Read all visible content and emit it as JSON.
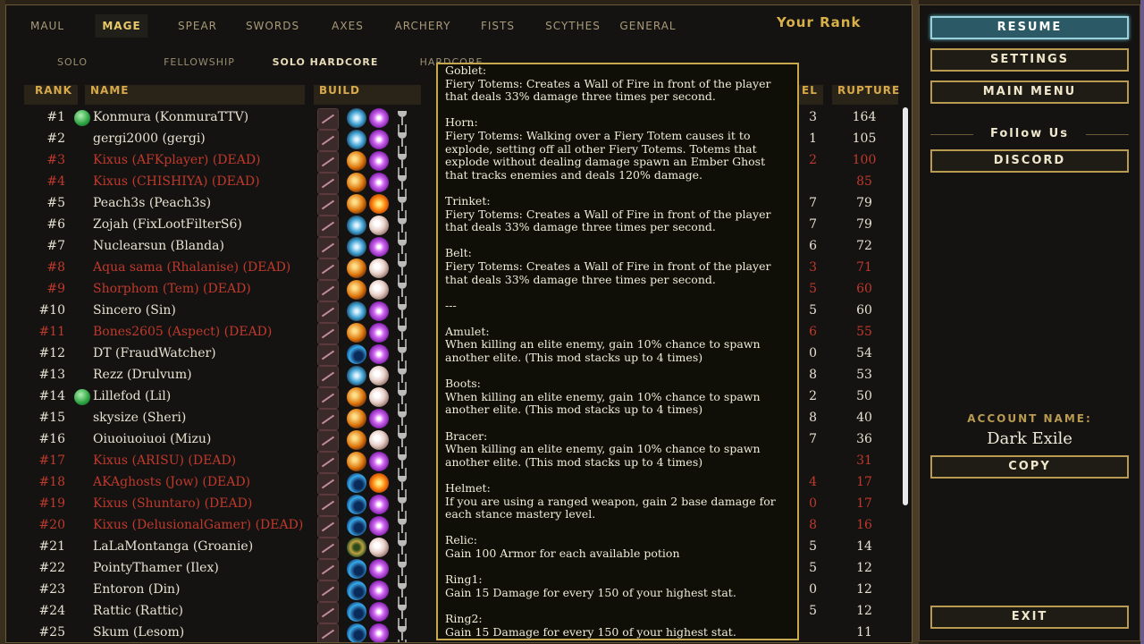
{
  "tabs": [
    "Maul",
    "Mage",
    "Spear",
    "Swords",
    "Axes",
    "Archery",
    "Fists",
    "Scythes",
    "General"
  ],
  "active_tab": "Mage",
  "your_rank_label": "Your Rank",
  "subtabs": [
    "Solo",
    "Fellowship",
    "Solo Hardcore",
    "Hardcore"
  ],
  "active_subtab": "Solo Hardcore",
  "headers": {
    "rank": "Rank",
    "name": "Name",
    "build": "Build",
    "level": "el",
    "rupture": "Rupture"
  },
  "rows": [
    {
      "rank": "#1",
      "name": "Konmura (KonmuraTTV)",
      "level": "3",
      "rupture": "164",
      "dead": false,
      "orb": true,
      "totem": "ice",
      "core": "arc"
    },
    {
      "rank": "#2",
      "name": "gergi2000 (gergi)",
      "level": "1",
      "rupture": "105",
      "dead": false,
      "orb": false,
      "totem": "ice",
      "core": "arc"
    },
    {
      "rank": "#3",
      "name": "Kixus (AFKplayer) (DEAD)",
      "level": "2",
      "rupture": "100",
      "dead": true,
      "orb": false,
      "totem": "fire",
      "core": "arc"
    },
    {
      "rank": "#4",
      "name": "Kixus (CHISHIYA) (DEAD)",
      "level": "",
      "rupture": "85",
      "dead": true,
      "orb": false,
      "totem": "fire",
      "core": "arc"
    },
    {
      "rank": "#5",
      "name": "Peach3s (Peach3s)",
      "level": "7",
      "rupture": "79",
      "dead": false,
      "orb": false,
      "totem": "fire",
      "core": "flame"
    },
    {
      "rank": "#6",
      "name": "Zojah (FixLootFilterS6)",
      "level": "7",
      "rupture": "79",
      "dead": false,
      "orb": false,
      "totem": "ice",
      "core": "pearl"
    },
    {
      "rank": "#7",
      "name": "Nuclearsun (Blanda)",
      "level": "6",
      "rupture": "72",
      "dead": false,
      "orb": false,
      "totem": "ice",
      "core": "arc"
    },
    {
      "rank": "#8",
      "name": "Aqua sama (Rhalanise) (DEAD)",
      "level": "3",
      "rupture": "71",
      "dead": true,
      "orb": false,
      "totem": "fire",
      "core": "pearl"
    },
    {
      "rank": "#9",
      "name": "Shorphom (Tem) (DEAD)",
      "level": "5",
      "rupture": "60",
      "dead": true,
      "orb": false,
      "totem": "fire",
      "core": "pearl"
    },
    {
      "rank": "#10",
      "name": "Sincero (Sin)",
      "level": "5",
      "rupture": "60",
      "dead": false,
      "orb": false,
      "totem": "ice",
      "core": "arc"
    },
    {
      "rank": "#11",
      "name": "Bones2605 (Aspect) (DEAD)",
      "level": "6",
      "rupture": "55",
      "dead": true,
      "orb": false,
      "totem": "fire",
      "core": "arc"
    },
    {
      "rank": "#12",
      "name": "DT (FraudWatcher)",
      "level": "0",
      "rupture": "54",
      "dead": false,
      "orb": false,
      "totem": "wave",
      "core": "arc"
    },
    {
      "rank": "#13",
      "name": "Rezz (Drulvum)",
      "level": "8",
      "rupture": "53",
      "dead": false,
      "orb": false,
      "totem": "ice",
      "core": "pearl"
    },
    {
      "rank": "#14",
      "name": "Lillefod (Lil)",
      "level": "2",
      "rupture": "50",
      "dead": false,
      "orb": true,
      "totem": "fire",
      "core": "pearl"
    },
    {
      "rank": "#15",
      "name": "skysize (Sheri)",
      "level": "8",
      "rupture": "40",
      "dead": false,
      "orb": false,
      "totem": "fire",
      "core": "arc"
    },
    {
      "rank": "#16",
      "name": "Oiuoiuoiuoi (Mizu)",
      "level": "7",
      "rupture": "36",
      "dead": false,
      "orb": false,
      "totem": "fire",
      "core": "pearl"
    },
    {
      "rank": "#17",
      "name": "Kixus (ARISU) (DEAD)",
      "level": "",
      "rupture": "31",
      "dead": true,
      "orb": false,
      "totem": "fire",
      "core": "arc"
    },
    {
      "rank": "#18",
      "name": "AKAghosts (Jow) (DEAD)",
      "level": "4",
      "rupture": "17",
      "dead": true,
      "orb": false,
      "totem": "wave",
      "core": "flame"
    },
    {
      "rank": "#19",
      "name": "Kixus (Shuntaro) (DEAD)",
      "level": "0",
      "rupture": "17",
      "dead": true,
      "orb": false,
      "totem": "wave",
      "core": "arc"
    },
    {
      "rank": "#20",
      "name": "Kixus (DelusionalGamer) (DEAD)",
      "level": "8",
      "rupture": "16",
      "dead": true,
      "orb": false,
      "totem": "wave",
      "core": "arc"
    },
    {
      "rank": "#21",
      "name": "LaLaMontanga (Groanie)",
      "level": "5",
      "rupture": "14",
      "dead": false,
      "orb": false,
      "totem": "ring",
      "core": "pearl"
    },
    {
      "rank": "#22",
      "name": "PointyThamer (Ilex)",
      "level": "5",
      "rupture": "12",
      "dead": false,
      "orb": false,
      "totem": "wave",
      "core": "arc"
    },
    {
      "rank": "#23",
      "name": "Entoron (Din)",
      "level": "0",
      "rupture": "12",
      "dead": false,
      "orb": false,
      "totem": "wave",
      "core": "arc"
    },
    {
      "rank": "#24",
      "name": "Rattic (Rattic)",
      "level": "5",
      "rupture": "12",
      "dead": false,
      "orb": false,
      "totem": "wave",
      "core": "arc"
    },
    {
      "rank": "#25",
      "name": "Skum (Lesom)",
      "level": "",
      "rupture": "11",
      "dead": false,
      "orb": false,
      "totem": "wave",
      "core": "arc"
    }
  ],
  "tooltip": [
    {
      "title": "Goblet:",
      "text": "Fiery Totems: Creates a Wall of Fire in front of the player that deals 33% damage three times per second."
    },
    {
      "title": "Horn:",
      "text": "Fiery Totems: Walking over a Fiery Totem causes it to explode, setting off all other Fiery Totems. Totems that explode without dealing damage spawn an Ember Ghost that tracks enemies and deals 120% damage."
    },
    {
      "title": "Trinket:",
      "text": "Fiery Totems: Creates a Wall of Fire in front of the player that deals 33% damage three times per second."
    },
    {
      "title": "Belt:",
      "text": "Fiery Totems: Creates a Wall of Fire in front of the player that deals 33% damage three times per second."
    },
    {
      "title": "---",
      "text": ""
    },
    {
      "title": "Amulet:",
      "text": "When killing an elite enemy, gain 10% chance to spawn another elite. (This mod stacks up to 4 times)"
    },
    {
      "title": "Boots:",
      "text": "When killing an elite enemy, gain 10% chance to spawn another elite. (This mod stacks up to 4 times)"
    },
    {
      "title": "Bracer:",
      "text": "When killing an elite enemy, gain 10% chance to spawn another elite. (This mod stacks up to 4 times)"
    },
    {
      "title": "Helmet:",
      "text": "If you are using a ranged weapon, gain 2 base damage for each stance mastery level."
    },
    {
      "title": "Relic:",
      "text": "Gain 100 Armor for each available potion"
    },
    {
      "title": "Ring1:",
      "text": "Gain 15 Damage for every 150 of your highest stat."
    },
    {
      "title": "Ring2:",
      "text": "Gain 15 Damage for every 150 of your highest stat."
    }
  ],
  "panel": {
    "resume": "Resume",
    "settings": "Settings",
    "main_menu": "Main Menu",
    "follow_us": "Follow Us",
    "discord": "Discord",
    "account_label": "Account Name:",
    "account_name": "Dark Exile",
    "copy": "Copy",
    "exit": "Exit"
  },
  "colors": {
    "accent_gold": "#d8a94a",
    "dead_red": "#c0392b",
    "resume_teal": "#2b5a66"
  }
}
